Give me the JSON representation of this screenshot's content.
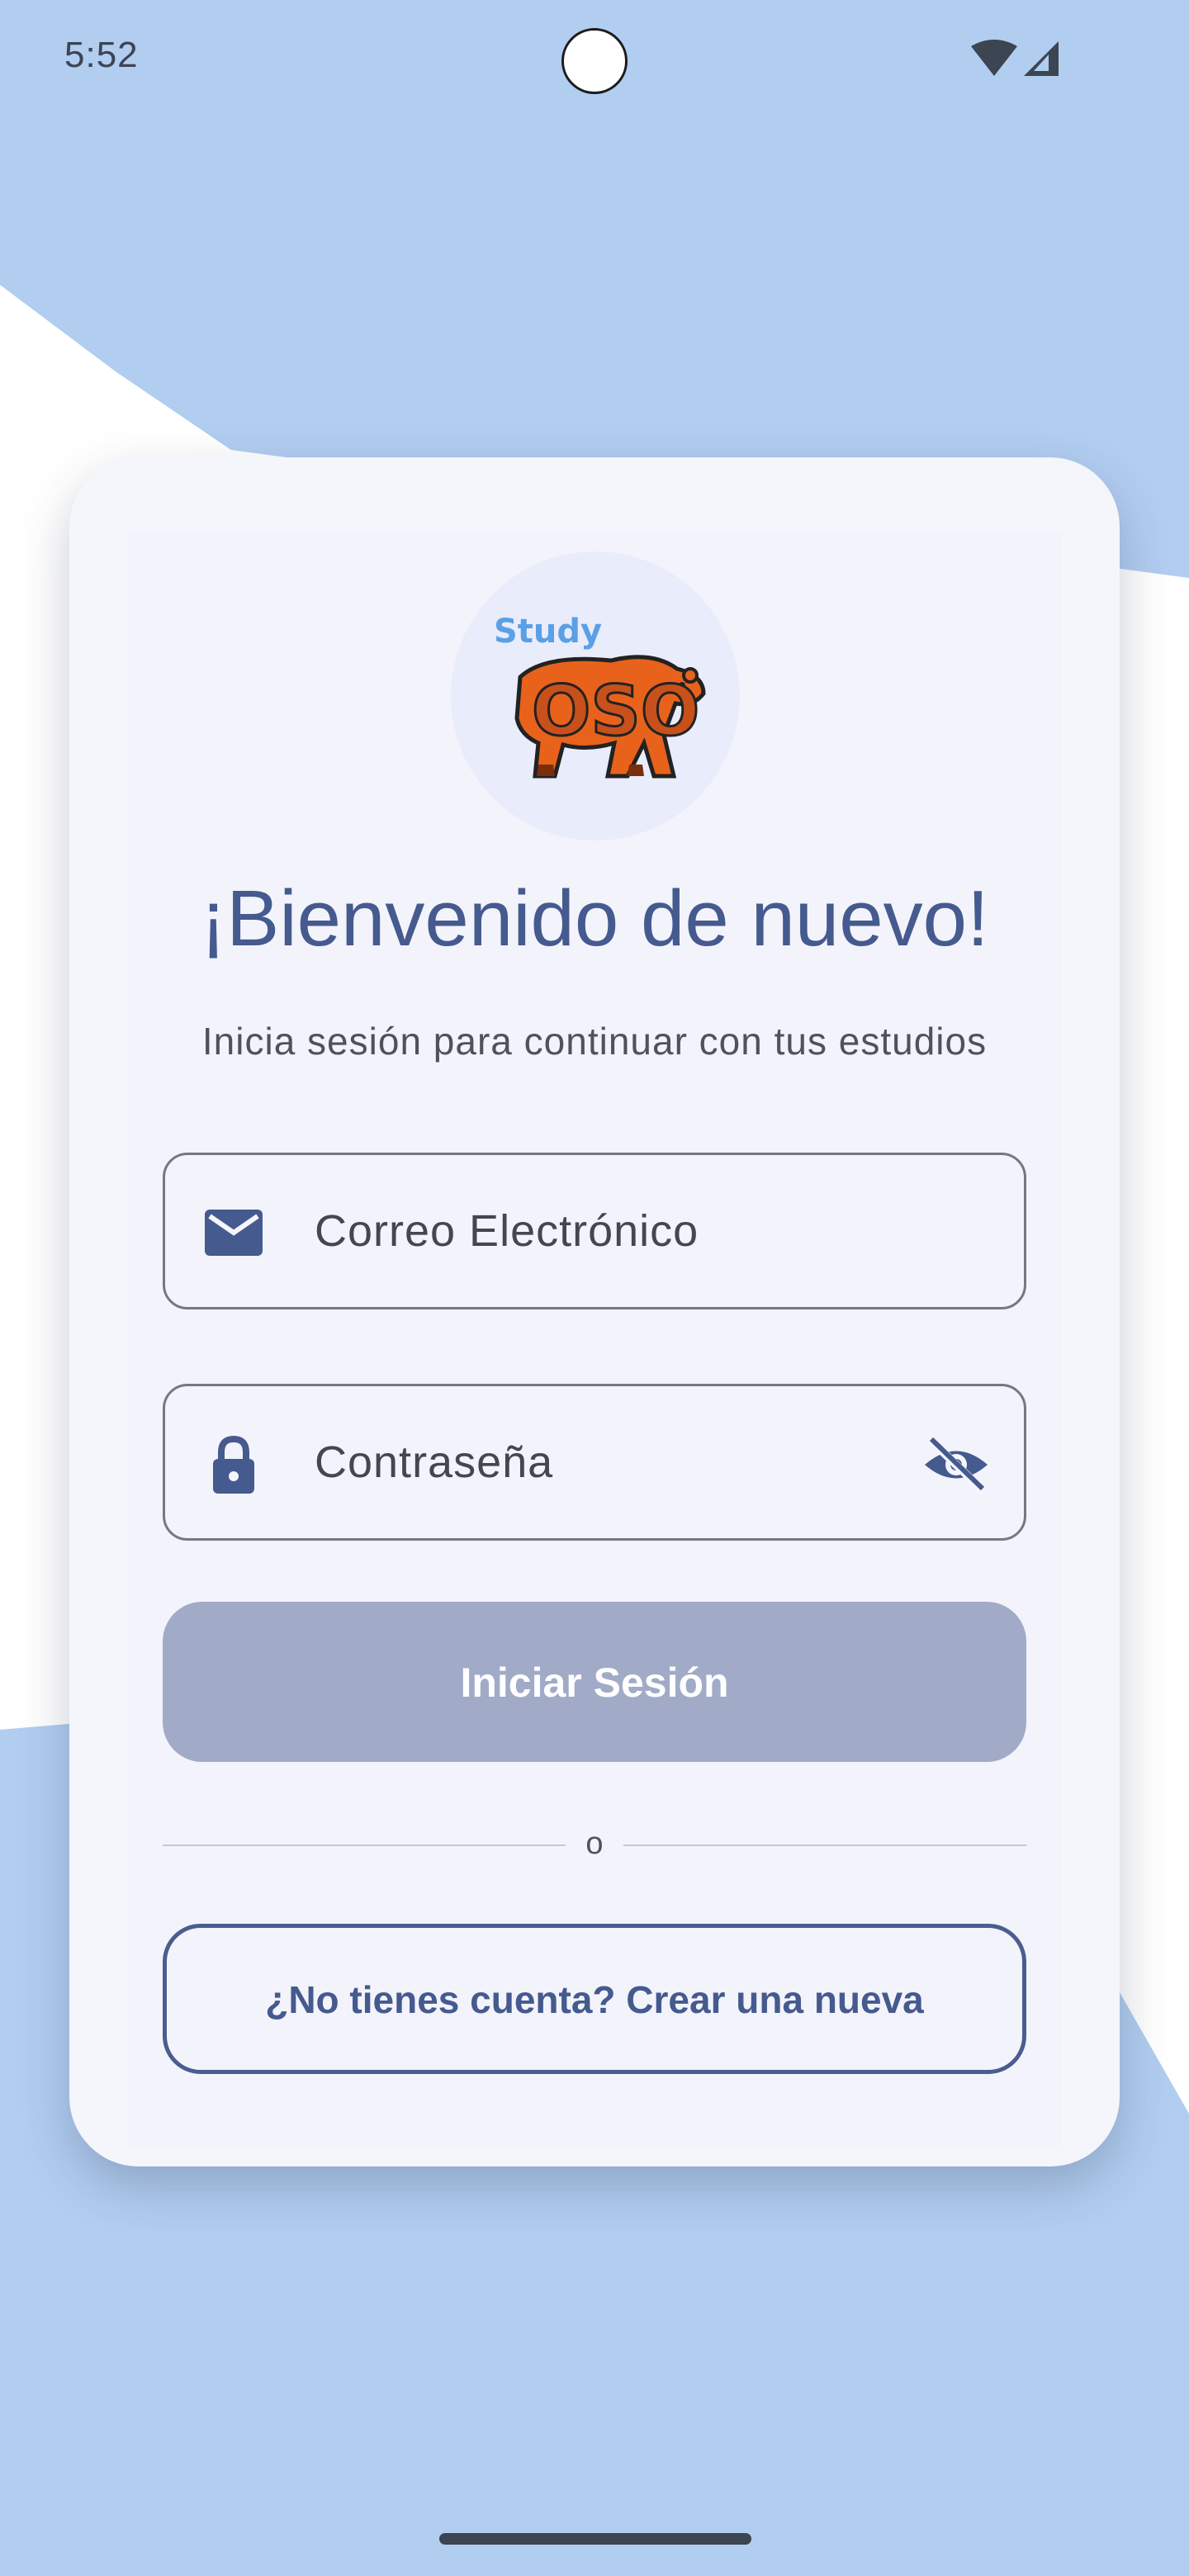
{
  "status_bar": {
    "time": "5:52",
    "icons": [
      "wifi-icon",
      "cellular-signal-icon"
    ]
  },
  "logo": {
    "small_text": "Study",
    "big_text": "OSO",
    "icon": "bear-logo-icon"
  },
  "login": {
    "title": "¡Bienvenido de nuevo!",
    "subtitle": "Inicia sesión para continuar con tus estudios",
    "email": {
      "placeholder": "Correo Electrónico",
      "value": "",
      "icon": "mail-icon"
    },
    "password": {
      "placeholder": "Contraseña",
      "value": "",
      "icon": "lock-icon",
      "toggle_icon": "visibility-off-icon"
    },
    "submit_label": "Iniciar Sesión",
    "divider_text": "o",
    "register_label": "¿No tienes cuenta? Crear una nueva"
  },
  "colors": {
    "background": "#b1cdf0",
    "card": "#f5f5fc",
    "primary": "#455a8e",
    "button_disabled": "#a1abc8",
    "logo_orange": "#e8621c",
    "logo_blue": "#5aa0e6"
  }
}
